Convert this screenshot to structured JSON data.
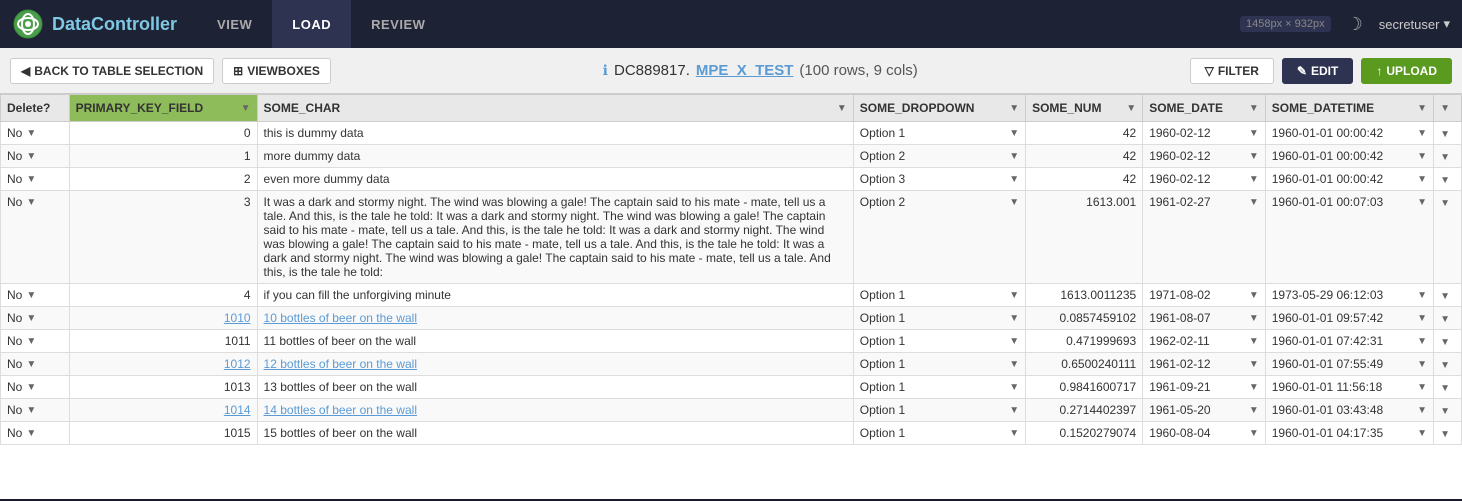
{
  "nav": {
    "logo_data": "DC",
    "logo_full": "DataController",
    "logo_highlight": "Data",
    "logo_rest": "Controller",
    "items": [
      {
        "label": "VIEW",
        "active": false
      },
      {
        "label": "LOAD",
        "active": true
      },
      {
        "label": "REVIEW",
        "active": false
      }
    ],
    "dim_info": "1458px × 932px",
    "user": "secretuser",
    "moon_icon": "☽"
  },
  "toolbar": {
    "back_label": "BACK TO TABLE SELECTION",
    "viewboxes_label": "VIEWBOXES",
    "info_icon": "ℹ",
    "table_id": "DC889817.",
    "table_name": "MPE_X_TEST",
    "table_stats": "(100 rows, 9 cols)",
    "filter_label": "FILTER",
    "edit_label": "EDIT",
    "upload_label": "UPLOAD"
  },
  "columns": [
    {
      "label": "Delete?",
      "sortable": false
    },
    {
      "label": "PRIMARY_KEY_FIELD",
      "sortable": true,
      "pk": true
    },
    {
      "label": "SOME_CHAR",
      "sortable": true
    },
    {
      "label": "SOME_DROPDOWN",
      "sortable": true
    },
    {
      "label": "SOME_NUM",
      "sortable": true
    },
    {
      "label": "SOME_DATE",
      "sortable": true
    },
    {
      "label": "SOME_DATETIME",
      "sortable": true
    },
    {
      "label": "",
      "sortable": true
    }
  ],
  "rows": [
    {
      "delete": "No",
      "pk": "0",
      "pk_link": false,
      "char_val": "this is dummy data",
      "dropdown": "Option 1",
      "num": "42",
      "date": "1960-02-12",
      "datetime": "1960-01-01 00:00:42"
    },
    {
      "delete": "No",
      "pk": "1",
      "pk_link": false,
      "char_val": "more dummy data",
      "dropdown": "Option 2",
      "num": "42",
      "date": "1960-02-12",
      "datetime": "1960-01-01 00:00:42"
    },
    {
      "delete": "No",
      "pk": "2",
      "pk_link": false,
      "char_val": "even more dummy data",
      "dropdown": "Option 3",
      "num": "42",
      "date": "1960-02-12",
      "datetime": "1960-01-01 00:00:42"
    },
    {
      "delete": "No",
      "pk": "3",
      "pk_link": false,
      "char_val": "It was a dark and stormy night.  The wind was blowing a gale!  The captain said to his mate - mate, tell us a tale.  And this, is the tale he told: It was a dark and stormy night.  The wind was blowing a gale!  The captain said to his mate - mate, tell us a tale.  And this, is the tale he told: It was a dark and stormy night.  The wind was blowing a gale!  The captain said to his mate - mate, tell us a tale.  And this, is the tale he told: It was a dark and stormy night.  The wind was blowing a gale!  The captain said to his mate - mate, tell us a tale.  And this, is the tale he told:",
      "dropdown": "Option 2",
      "num": "1613.001",
      "date": "1961-02-27",
      "datetime": "1960-01-01 00:07:03"
    },
    {
      "delete": "No",
      "pk": "4",
      "pk_link": false,
      "char_val": "if you can fill the unforgiving minute",
      "dropdown": "Option 1",
      "num": "1613.0011235",
      "date": "1971-08-02",
      "datetime": "1973-05-29 06:12:03"
    },
    {
      "delete": "No",
      "pk": "1010",
      "pk_link": true,
      "char_val": "10 bottles of beer on the wall",
      "dropdown": "Option 1",
      "num": "0.0857459102",
      "date": "1961-08-07",
      "datetime": "1960-01-01 09:57:42"
    },
    {
      "delete": "No",
      "pk": "1011",
      "pk_link": false,
      "char_val": "11 bottles of beer on the wall",
      "dropdown": "Option 1",
      "num": "0.471999693",
      "date": "1962-02-11",
      "datetime": "1960-01-01 07:42:31"
    },
    {
      "delete": "No",
      "pk": "1012",
      "pk_link": true,
      "char_val": "12 bottles of beer on the wall",
      "dropdown": "Option 1",
      "num": "0.6500240111",
      "date": "1961-02-12",
      "datetime": "1960-01-01 07:55:49"
    },
    {
      "delete": "No",
      "pk": "1013",
      "pk_link": false,
      "char_val": "13 bottles of beer on the wall",
      "dropdown": "Option 1",
      "num": "0.9841600717",
      "date": "1961-09-21",
      "datetime": "1960-01-01 11:56:18"
    },
    {
      "delete": "No",
      "pk": "1014",
      "pk_link": true,
      "char_val": "14 bottles of beer on the wall",
      "dropdown": "Option 1",
      "num": "0.2714402397",
      "date": "1961-05-20",
      "datetime": "1960-01-01 03:43:48"
    },
    {
      "delete": "No",
      "pk": "1015",
      "pk_link": false,
      "char_val": "15 bottles of beer on the wall",
      "dropdown": "Option 1",
      "num": "0.1520279074",
      "date": "1960-08-04",
      "datetime": "1960-01-01 04:17:35"
    }
  ]
}
